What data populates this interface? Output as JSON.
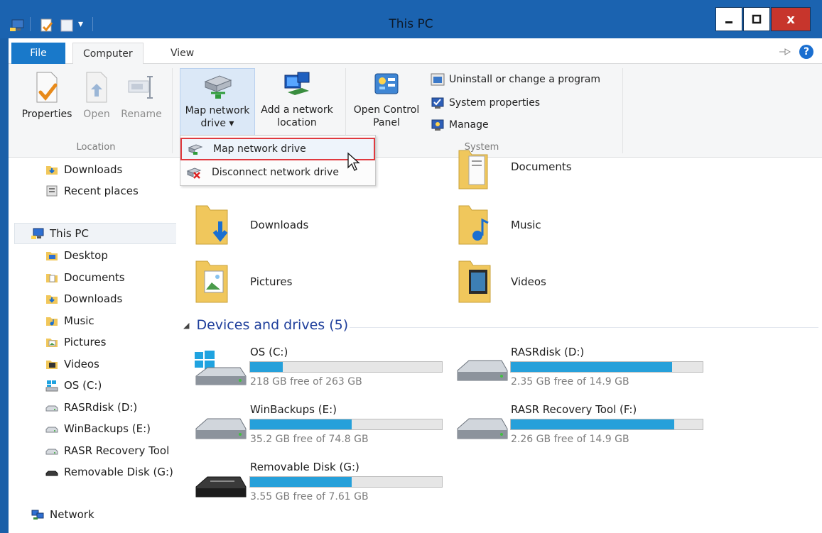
{
  "window": {
    "title": "This PC"
  },
  "tabs": {
    "file": "File",
    "computer": "Computer",
    "view": "View"
  },
  "ribbon": {
    "location": {
      "label": "Location",
      "properties": "Properties",
      "open": "Open",
      "rename": "Rename"
    },
    "network": {
      "map_line1": "Map network",
      "map_line2": "drive ▾",
      "add_line1": "Add a network",
      "add_line2": "location"
    },
    "system": {
      "label": "System",
      "open_cp_line1": "Open Control",
      "open_cp_line2": "Panel",
      "uninstall": "Uninstall or change a program",
      "sysprops": "System properties",
      "manage": "Manage"
    }
  },
  "dropdown": {
    "map": "Map network drive",
    "disconnect": "Disconnect network drive"
  },
  "nav": {
    "quick": [
      {
        "label": "Downloads",
        "icon": "downloads-folder-icon"
      },
      {
        "label": "Recent places",
        "icon": "recent-places-icon"
      }
    ],
    "thispc": "This PC",
    "items": [
      {
        "label": "Desktop",
        "icon": "desktop-folder-icon"
      },
      {
        "label": "Documents",
        "icon": "documents-folder-icon"
      },
      {
        "label": "Downloads",
        "icon": "downloads-folder-icon"
      },
      {
        "label": "Music",
        "icon": "music-folder-icon"
      },
      {
        "label": "Pictures",
        "icon": "pictures-folder-icon"
      },
      {
        "label": "Videos",
        "icon": "videos-folder-icon"
      },
      {
        "label": "OS (C:)",
        "icon": "os-drive-icon"
      },
      {
        "label": "RASRdisk (D:)",
        "icon": "drive-icon"
      },
      {
        "label": "WinBackups (E:)",
        "icon": "drive-icon"
      },
      {
        "label": "RASR Recovery Tool",
        "icon": "drive-icon"
      },
      {
        "label": "Removable Disk (G:)",
        "icon": "removable-drive-icon"
      }
    ],
    "network": "Network"
  },
  "folders": [
    {
      "name": "Documents"
    },
    {
      "name": "Downloads"
    },
    {
      "name": "Music"
    },
    {
      "name": "Pictures"
    },
    {
      "name": "Videos"
    }
  ],
  "devices": {
    "heading": "Devices and drives (5)",
    "drives": [
      {
        "name": "OS (C:)",
        "free": "218 GB free of 263 GB",
        "used_fraction": 0.17
      },
      {
        "name": "RASRdisk (D:)",
        "free": "2.35 GB free of 14.9 GB",
        "used_fraction": 0.84
      },
      {
        "name": "WinBackups (E:)",
        "free": "35.2 GB free of 74.8 GB",
        "used_fraction": 0.53
      },
      {
        "name": "RASR Recovery Tool (F:)",
        "free": "2.26 GB free of 14.9 GB",
        "used_fraction": 0.85
      },
      {
        "name": "Removable Disk (G:)",
        "free": "3.55 GB free of 7.61 GB",
        "used_fraction": 0.53
      }
    ]
  },
  "colors": {
    "titlebar": "#1b63b0",
    "accent": "#1979ca",
    "close": "#c7352c",
    "drive_bar": "#26a0da",
    "highlight_box": "#e0393f"
  }
}
